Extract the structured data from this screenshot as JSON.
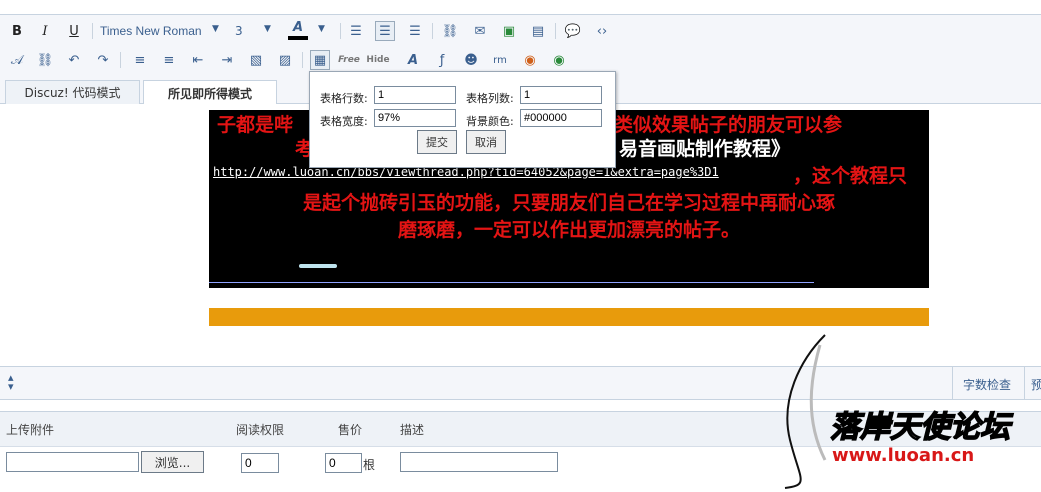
{
  "toolbar": {
    "font_name": "Times New Roman",
    "font_size": "3"
  },
  "tabs": [
    {
      "label": "Discuz! 代码模式"
    },
    {
      "label": "所见即所得模式"
    }
  ],
  "editor": {
    "lines": [
      "子都是哔",
      "类似效果帖子的朋友可以参",
      "考",
      "易音画贴制作教程》"
    ],
    "url": "http://www.luoan.cn/bbs/viewthread.php?tid=64052&page=1&extra=page%3D1",
    "after_url": "，这个教程只",
    "line5": "是起个抛砖引玉的功能，只要朋友们自己在学习过程中再耐心琢",
    "line6": "磨琢磨，一定可以作出更加漂亮的帖子。"
  },
  "table_popup": {
    "rows_label": "表格行数:",
    "rows_value": "1",
    "cols_label": "表格列数:",
    "cols_value": "1",
    "width_label": "表格宽度:",
    "width_value": "97%",
    "bg_label": "背景颜色:",
    "bg_value": "#000000",
    "submit": "提交",
    "cancel": "取消"
  },
  "statusbar": {
    "word_check": "字数检查",
    "preview": "预"
  },
  "attachments": {
    "upload_label": "上传附件",
    "read_perm_label": "阅读权限",
    "price_label": "售价",
    "desc_label": "描述",
    "browse": "浏览...",
    "read_perm_value": "0",
    "price_value": "0",
    "price_unit": "根"
  },
  "watermark": {
    "site_name": "落岸天使论坛",
    "site_url": "www.luoan.cn"
  },
  "colors": {
    "accent": "#3a5f8e",
    "orange_bar": "#e89b0c",
    "red_text": "#e41414"
  }
}
